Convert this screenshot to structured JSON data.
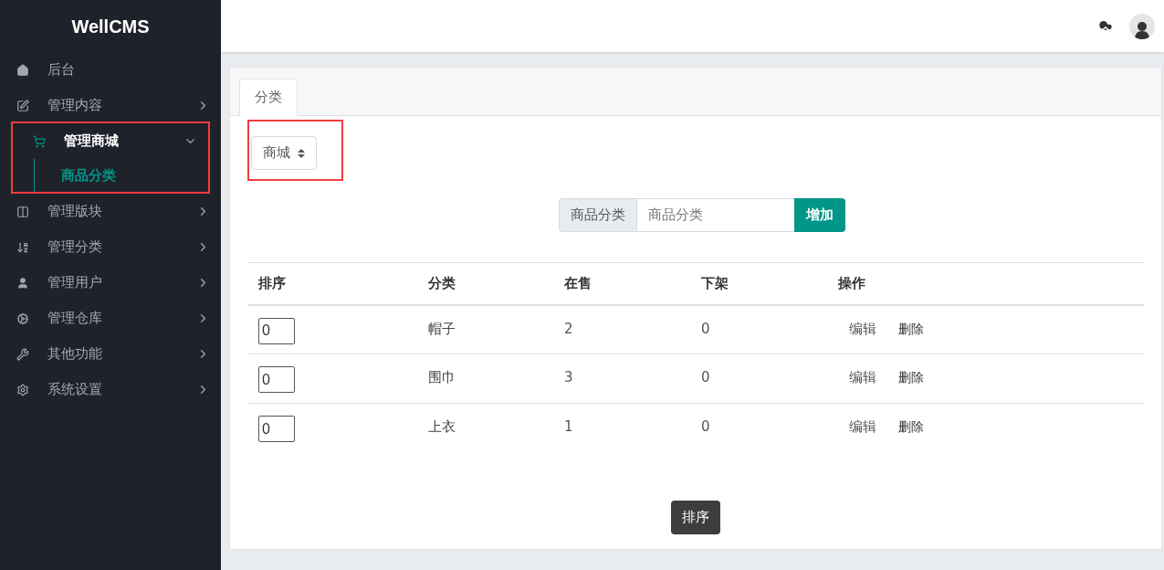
{
  "brand": "WellCMS",
  "sidebar": {
    "items": [
      {
        "label": "后台",
        "selected": false
      },
      {
        "label": "管理内容",
        "selected": false,
        "expanded": false
      },
      {
        "label": "管理商城",
        "selected": true,
        "expanded": true,
        "highlighted": true,
        "children": [
          {
            "label": "商品分类",
            "selected": true
          }
        ]
      },
      {
        "label": "管理版块",
        "selected": false,
        "expanded": false
      },
      {
        "label": "管理分类",
        "selected": false,
        "expanded": false
      },
      {
        "label": "管理用户",
        "selected": false,
        "expanded": false
      },
      {
        "label": "管理仓库",
        "selected": false,
        "expanded": false
      },
      {
        "label": "其他功能",
        "selected": false,
        "expanded": false
      },
      {
        "label": "系统设置",
        "selected": false,
        "expanded": false
      }
    ]
  },
  "tabs": [
    {
      "label": "分类",
      "selected": true
    }
  ],
  "store_select": {
    "value": "商城",
    "highlighted": true
  },
  "add_form": {
    "addon": "商品分类",
    "placeholder": "商品分类",
    "button": "增加"
  },
  "table": {
    "columns": [
      "排序",
      "分类",
      "在售",
      "下架",
      "操作"
    ],
    "rows": [
      {
        "order": "0",
        "category": "帽子",
        "on_sale": "2",
        "off_shelf": "0",
        "edit": "编辑",
        "delete": "删除"
      },
      {
        "order": "0",
        "category": "围巾",
        "on_sale": "3",
        "off_shelf": "0",
        "edit": "编辑",
        "delete": "删除"
      },
      {
        "order": "0",
        "category": "上衣",
        "on_sale": "1",
        "off_shelf": "0",
        "edit": "编辑",
        "delete": "删除"
      }
    ]
  },
  "sort_button": "排序"
}
